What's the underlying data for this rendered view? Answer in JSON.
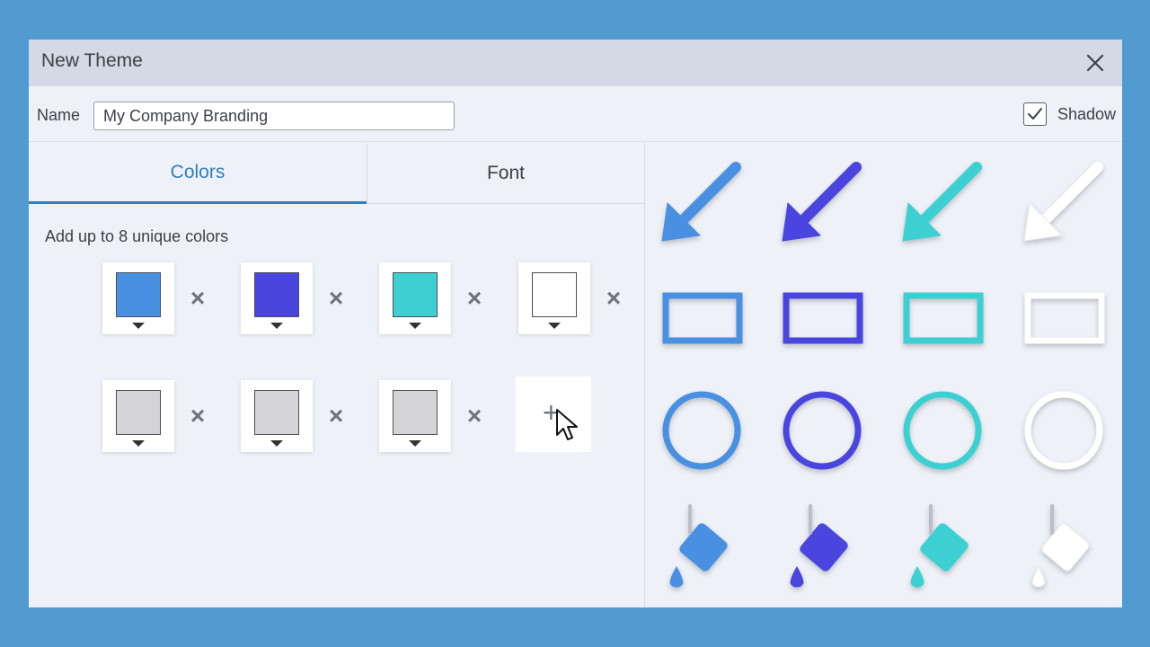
{
  "dialog": {
    "title": "New Theme",
    "name_label": "Name",
    "name_value": "My Company Branding",
    "shadow_label": "Shadow",
    "shadow_checked": true
  },
  "tabs": [
    {
      "label": "Colors",
      "active": true
    },
    {
      "label": "Font",
      "active": false
    }
  ],
  "colors_hint": "Add up to 8 unique colors",
  "swatches": [
    {
      "color": "#4a90e2",
      "label": "blue"
    },
    {
      "color": "#4b45e0",
      "label": "indigo"
    },
    {
      "color": "#3dd0d3",
      "label": "teal"
    },
    {
      "color": "#ffffff",
      "label": "white"
    },
    {
      "color": "#d4d3d6",
      "label": "unset"
    },
    {
      "color": "#d4d3d6",
      "label": "unset"
    },
    {
      "color": "#d4d3d6",
      "label": "unset"
    }
  ],
  "icons": {
    "close": "close-icon",
    "remove": "×",
    "add": "+"
  },
  "preview_colors": [
    "#4a90e2",
    "#4b45e0",
    "#3dd0d3",
    "#ffffff"
  ],
  "preview_shapes": [
    "arrow",
    "rectangle",
    "circle",
    "fill-bucket"
  ]
}
